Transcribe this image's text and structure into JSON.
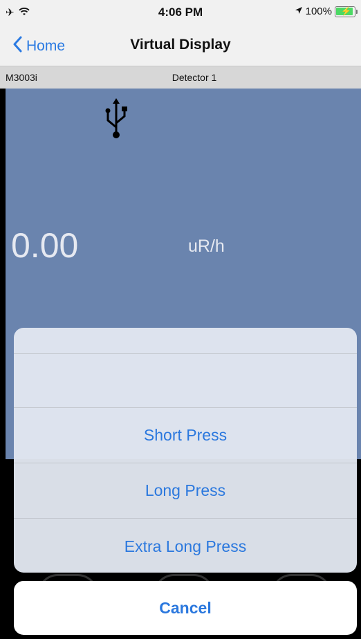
{
  "status_bar": {
    "time": "4:06 PM",
    "battery_percent": "100%",
    "left_icons": [
      "airplane-icon",
      "wifi-icon"
    ],
    "right_icons": [
      "location-icon",
      "battery-charging-icon"
    ]
  },
  "nav": {
    "back_label": "Home",
    "title": "Virtual Display"
  },
  "device": {
    "model": "M3003i",
    "detector": "Detector 1",
    "connection_icon": "usb-icon"
  },
  "reading": {
    "value": "0.00",
    "unit": "uR/h"
  },
  "action_sheet": {
    "options": [
      "Short Press",
      "Long Press",
      "Extra Long Press"
    ],
    "cancel_label": "Cancel"
  },
  "colors": {
    "accent": "#2b78de",
    "display_background": "#6a84ae",
    "battery_fill": "#4cd964"
  }
}
